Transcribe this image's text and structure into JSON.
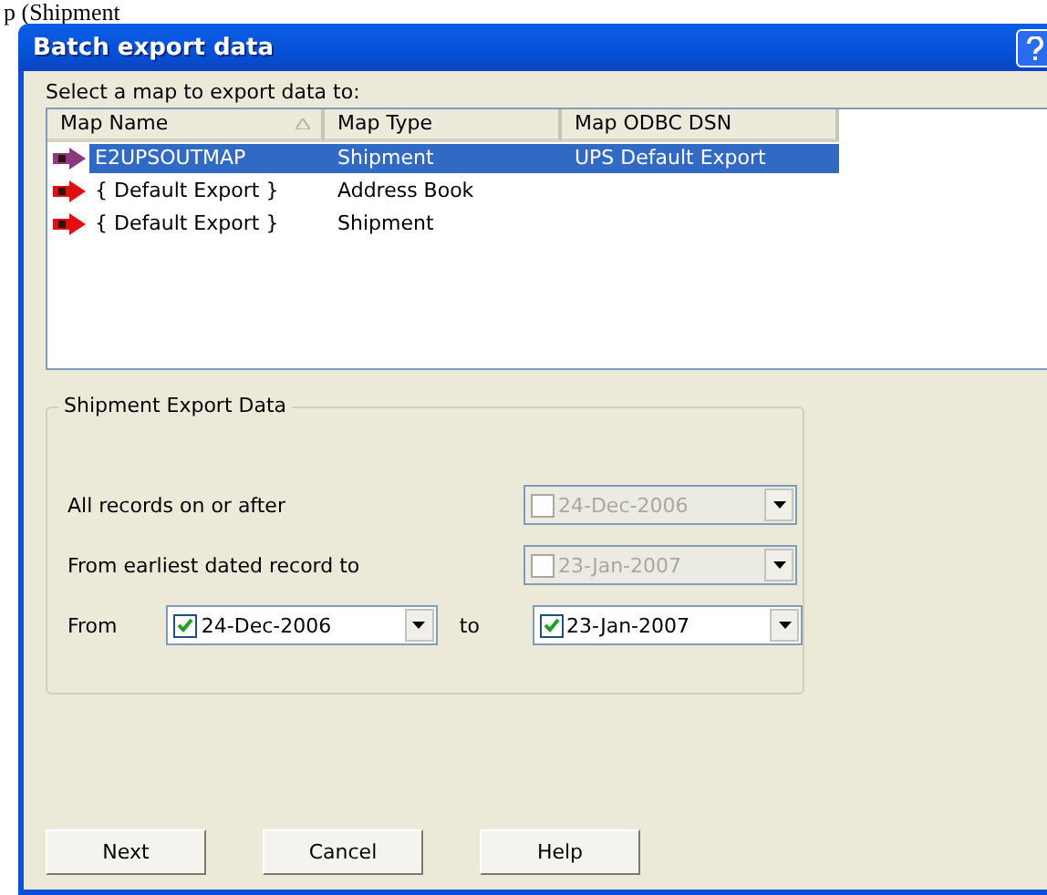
{
  "backdrop_text": "p (Shipment",
  "window": {
    "title": "Batch export data"
  },
  "list_label": "Select a map to export data to:",
  "table": {
    "columns": [
      {
        "label": "Map Name",
        "sorted": true
      },
      {
        "label": "Map Type",
        "sorted": false
      },
      {
        "label": "Map ODBC DSN",
        "sorted": false
      }
    ],
    "rows": [
      {
        "selected": true,
        "cells": [
          "E2UPSOUTMAP",
          "Shipment",
          "UPS Default Export"
        ]
      },
      {
        "selected": false,
        "cells": [
          "{ Default Export }",
          "Address Book",
          ""
        ]
      },
      {
        "selected": false,
        "cells": [
          "{ Default Export }",
          "Shipment",
          ""
        ]
      }
    ]
  },
  "group": {
    "title": "Shipment Export Data",
    "options": [
      {
        "label": "All records on or after",
        "picker": {
          "checked": false,
          "disabled": true,
          "value": "24-Dec-2006"
        }
      },
      {
        "label": "From earliest dated record to",
        "picker": {
          "checked": false,
          "disabled": true,
          "value": "23-Jan-2007"
        }
      }
    ],
    "range": {
      "label": "From",
      "from": {
        "checked": true,
        "disabled": false,
        "value": "24-Dec-2006"
      },
      "to_label": "to",
      "to": {
        "checked": true,
        "disabled": false,
        "value": "23-Jan-2007"
      }
    }
  },
  "buttons": [
    "Next",
    "Cancel",
    "Help"
  ]
}
